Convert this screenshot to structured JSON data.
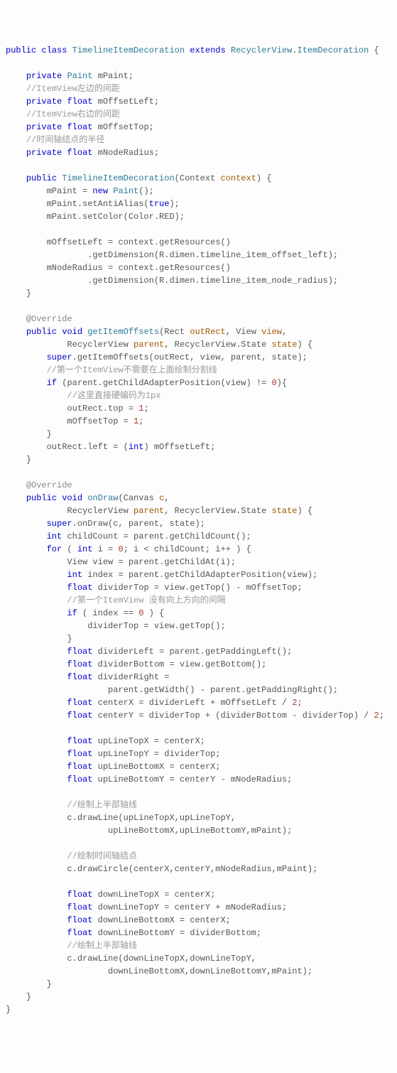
{
  "code": {
    "l1": {
      "a": "public class",
      "b": "TimelineItemDecoration",
      "c": "extends",
      "d": "RecyclerView",
      "e": ".",
      "f": "ItemDecoration",
      "g": " {"
    },
    "l2": {
      "a": "private",
      "b": "Paint",
      "c": " mPaint;"
    },
    "l3": "//ItemView左边的间距",
    "l4": {
      "a": "private float",
      "b": " mOffsetLeft;"
    },
    "l5": "//ItemView右边的间距",
    "l6": {
      "a": "private float",
      "b": " mOffsetTop;"
    },
    "l7": "//时间轴结点的半径",
    "l8": {
      "a": "private float",
      "b": " mNodeRadius;"
    },
    "l9": {
      "a": "public",
      "b": "TimelineItemDecoration",
      "c": "(Context",
      "d": "context",
      "e": ") {"
    },
    "l10": {
      "a": "mPaint = ",
      "b": "new",
      "c": "Paint",
      "d": "();"
    },
    "l11": {
      "a": "mPaint.setAntiAlias(",
      "b": "true",
      "c": ");"
    },
    "l12": {
      "a": "mPaint.setColor(Color.",
      "b": "RED",
      "c": ");"
    },
    "l13": "mOffsetLeft = context.getResources()",
    "l14": {
      "a": ".getDimension(R.dimen.",
      "b": "timeline_item_offset_left",
      "c": ");"
    },
    "l15": "mNodeRadius = context.getResources()",
    "l16": {
      "a": ".getDimension(R.dimen.",
      "b": "timeline_item_node_radius",
      "c": ");"
    },
    "l17": "}",
    "l18": "@Override",
    "l19": {
      "a": "public void",
      "b": "getItemOffsets",
      "c": "(Rect",
      "d": "outRect",
      "e": ", View",
      "f": "view",
      "g": ","
    },
    "l20": {
      "a": "RecyclerView",
      "b": "parent",
      "c": ", RecyclerView.State",
      "d": "state",
      "e": ") {"
    },
    "l21": {
      "a": "super",
      "b": ".getItemOffsets(outRect, view, parent, state);"
    },
    "l22": "//第一个ItemView不需要在上面绘制分割线",
    "l23": {
      "a": "if",
      "b": " (parent.getChildAdapterPosition(view) != ",
      "c": "0",
      "d": "){"
    },
    "l24": "//这里直接硬编码为1px",
    "l25": {
      "a": "outRect.",
      "b": "top",
      "c": " = ",
      "d": "1",
      "e": ";"
    },
    "l26": {
      "a": "mOffsetTop = ",
      "b": "1",
      "c": ";"
    },
    "l27": "}",
    "l28": {
      "a": "outRect.",
      "b": "left",
      "c": " = (",
      "d": "int",
      "e": ") mOffsetLeft;"
    },
    "l29": "}",
    "l30": "@Override",
    "l31": {
      "a": "public void",
      "b": "onDraw",
      "c": "(Canvas",
      "d": "c",
      "e": ","
    },
    "l32": {
      "a": "RecyclerView",
      "b": "parent",
      "c": ", RecyclerView.State",
      "d": "state",
      "e": ") {"
    },
    "l33": {
      "a": "super",
      "b": ".onDraw(c, parent, state);"
    },
    "l34": {
      "a": "int",
      "b": " childCount = parent.getChildCount();"
    },
    "l35": {
      "a": "for",
      "b": " ( ",
      "c": "int",
      "d": " i = ",
      "e": "0",
      "f": "; i < childCount; i++ ) {"
    },
    "l36": "View view = parent.getChildAt(i);",
    "l37": {
      "a": "int",
      "b": " index = parent.getChildAdapterPosition(view);"
    },
    "l38": {
      "a": "float",
      "b": " dividerTop = view.getTop() - mOffsetTop;"
    },
    "l39": "//第一个ItemView 没有向上方向的间隔",
    "l40": {
      "a": "if",
      "b": " ( index == ",
      "c": "0",
      "d": " ) {"
    },
    "l41": "dividerTop = view.getTop();",
    "l42": "}",
    "l43": {
      "a": "float",
      "b": " dividerLeft = parent.getPaddingLeft();"
    },
    "l44": {
      "a": "float",
      "b": " dividerBottom = view.getBottom();"
    },
    "l45": {
      "a": "float",
      "b": " dividerRight ="
    },
    "l46": "parent.getWidth() - parent.getPaddingRight();",
    "l47": {
      "a": "float",
      "b": " centerX = dividerLeft + mOffsetLeft / ",
      "c": "2",
      "d": ";"
    },
    "l48": {
      "a": "float",
      "b": " centerY = dividerTop + (dividerBottom - dividerTop) / ",
      "c": "2",
      "d": ";"
    },
    "l49": {
      "a": "float",
      "b": " upLineTopX = centerX;"
    },
    "l50": {
      "a": "float",
      "b": " upLineTopY = dividerTop;"
    },
    "l51": {
      "a": "float",
      "b": " upLineBottomX = centerX;"
    },
    "l52": {
      "a": "float",
      "b": " upLineBottomY = centerY - mNodeRadius;"
    },
    "l53": "//绘制上半部轴线",
    "l54": "c.drawLine(upLineTopX,upLineTopY,",
    "l55": "upLineBottomX,upLineBottomY,mPaint);",
    "l56": "//绘制时间轴结点",
    "l57": "c.drawCircle(centerX,centerY,mNodeRadius,mPaint);",
    "l58": {
      "a": "float",
      "b": " downLineTopX = centerX;"
    },
    "l59": {
      "a": "float",
      "b": " downLineTopY = centerY + mNodeRadius;"
    },
    "l60": {
      "a": "float",
      "b": " downLineBottomX = centerX;"
    },
    "l61": {
      "a": "float",
      "b": " downLineBottomY = dividerBottom;"
    },
    "l62": "//绘制上半部轴线",
    "l63": "c.drawLine(downLineTopX,downLineTopY,",
    "l64": "downLineBottomX,downLineBottomY,mPaint);",
    "l65": "}",
    "l66": "}",
    "l67": "}"
  }
}
